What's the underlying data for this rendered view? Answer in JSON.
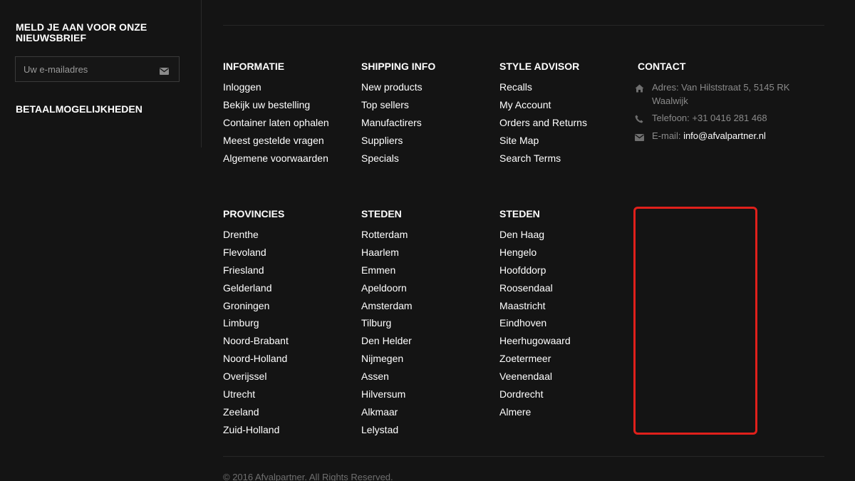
{
  "sidebar": {
    "newsletter_title": "MELD JE AAN VOOR ONZE NIEUWSBRIEF",
    "email_placeholder": "Uw e-mailadres",
    "payment_title": "BETAALMOGELIJKHEDEN"
  },
  "informatie": {
    "title": "INFORMATIE",
    "links": [
      "Inloggen",
      "Bekijk uw bestelling",
      "Container laten ophalen",
      "Meest gestelde vragen",
      "Algemene voorwaarden"
    ]
  },
  "shipping": {
    "title": "SHIPPING INFO",
    "links": [
      "New products",
      "Top sellers",
      "Manufactirers",
      "Suppliers",
      "Specials"
    ]
  },
  "style_advisor": {
    "title": "STYLE ADVISOR",
    "links": [
      "Recalls",
      "My Account",
      "Orders and Returns",
      "Site Map",
      "Search Terms"
    ]
  },
  "contact": {
    "title": "CONTACT",
    "address": "Adres: Van Hilststraat 5, 5145 RK Waalwijk",
    "phone": "Telefoon: +31 0416 281 468",
    "email_label": "E-mail: ",
    "email": "info@afvalpartner.nl"
  },
  "provincies": {
    "title": "PROVINCIES",
    "links": [
      "Drenthe",
      "Flevoland",
      "Friesland",
      "Gelderland",
      "Groningen",
      "Limburg",
      "Noord-Brabant",
      "Noord-Holland",
      "Overijssel",
      "Utrecht",
      "Zeeland",
      "Zuid-Holland"
    ]
  },
  "steden1": {
    "title": "STEDEN",
    "links": [
      "Rotterdam",
      "Haarlem",
      "Emmen",
      "Apeldoorn",
      "Amsterdam",
      "Tilburg",
      "Den Helder",
      "Nijmegen",
      "Assen",
      "Hilversum",
      "Alkmaar",
      "Lelystad"
    ]
  },
  "steden2": {
    "title": "STEDEN",
    "links": [
      "Den Haag",
      "Hengelo",
      "Hoofddorp",
      "Roosendaal",
      "Maastricht",
      "Eindhoven",
      "Heerhugowaard",
      "Zoetermeer",
      "Veenendaal",
      "Dordrecht",
      "Almere"
    ]
  },
  "footer": {
    "copyright": "© 2016 Afvalpartner. All Rights Reserved."
  },
  "colors": {
    "background": "#141414",
    "text": "#ffffff",
    "muted": "#8a8a8a",
    "highlight": "#e0201b"
  },
  "icons": {
    "newsletter_submit": "envelope-icon",
    "address": "home-icon",
    "phone": "phone-icon",
    "email": "envelope-icon"
  }
}
